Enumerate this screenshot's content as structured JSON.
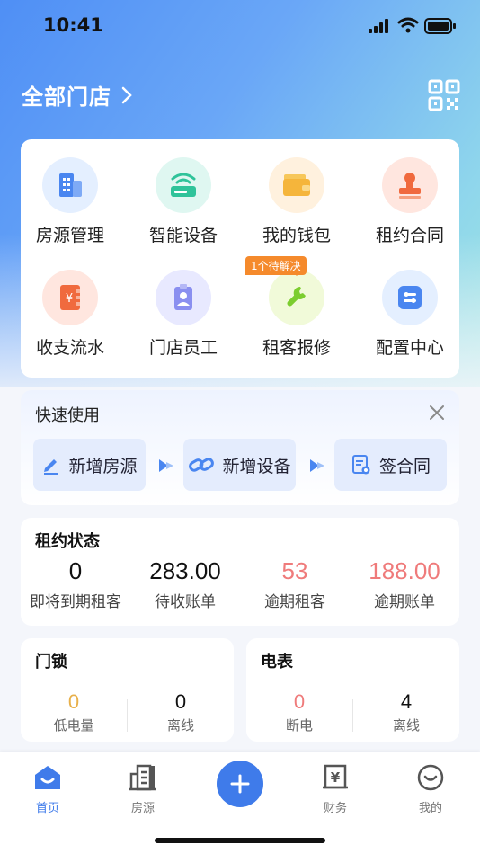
{
  "status_bar": {
    "time": "10:41"
  },
  "header": {
    "title": "全部门店"
  },
  "grid": [
    {
      "label": "房源管理",
      "icon": "building-icon",
      "bg": "#e4efff"
    },
    {
      "label": "智能设备",
      "icon": "router-icon",
      "bg": "#dff7f1"
    },
    {
      "label": "我的钱包",
      "icon": "wallet-icon",
      "bg": "#fff1de"
    },
    {
      "label": "租约合同",
      "icon": "stamp-icon",
      "bg": "#ffe6df"
    },
    {
      "label": "收支流水",
      "icon": "ledger-icon",
      "bg": "#ffe6df"
    },
    {
      "label": "门店员工",
      "icon": "badge-icon",
      "bg": "#e8e9ff"
    },
    {
      "label": "租客报修",
      "icon": "wrench-icon",
      "bg": "#f1fad9"
    },
    {
      "label": "配置中心",
      "icon": "settings-icon",
      "bg": "#e4efff"
    }
  ],
  "repair_badge": "1个待解决",
  "quick": {
    "title": "快速使用",
    "buttons": [
      "新增房源",
      "新增设备",
      "签合同"
    ]
  },
  "lease": {
    "title": "租约状态",
    "stats": [
      {
        "value": "0",
        "label": "即将到期租客",
        "color": "#111111"
      },
      {
        "value": "283.00",
        "label": "待收账单",
        "color": "#111111"
      },
      {
        "value": "53",
        "label": "逾期租客",
        "color": "#ef7b7b"
      },
      {
        "value": "188.00",
        "label": "逾期账单",
        "color": "#ef7b7b"
      }
    ]
  },
  "lock": {
    "title": "门锁",
    "items": [
      {
        "value": "0",
        "label": "低电量",
        "color": "#e8b04a"
      },
      {
        "value": "0",
        "label": "离线",
        "color": "#111111"
      }
    ]
  },
  "meter": {
    "title": "电表",
    "items": [
      {
        "value": "0",
        "label": "断电",
        "color": "#ef7b7b"
      },
      {
        "value": "4",
        "label": "离线",
        "color": "#111111"
      }
    ]
  },
  "tabs": [
    {
      "label": "首页",
      "icon": "home-icon",
      "active": true
    },
    {
      "label": "房源",
      "icon": "property-icon"
    },
    {
      "label": "财务",
      "icon": "finance-icon"
    },
    {
      "label": "我的",
      "icon": "profile-icon"
    }
  ],
  "colors": {
    "accent": "#3f7bea",
    "overdue": "#ef7b7b",
    "warning": "#e8b04a"
  }
}
